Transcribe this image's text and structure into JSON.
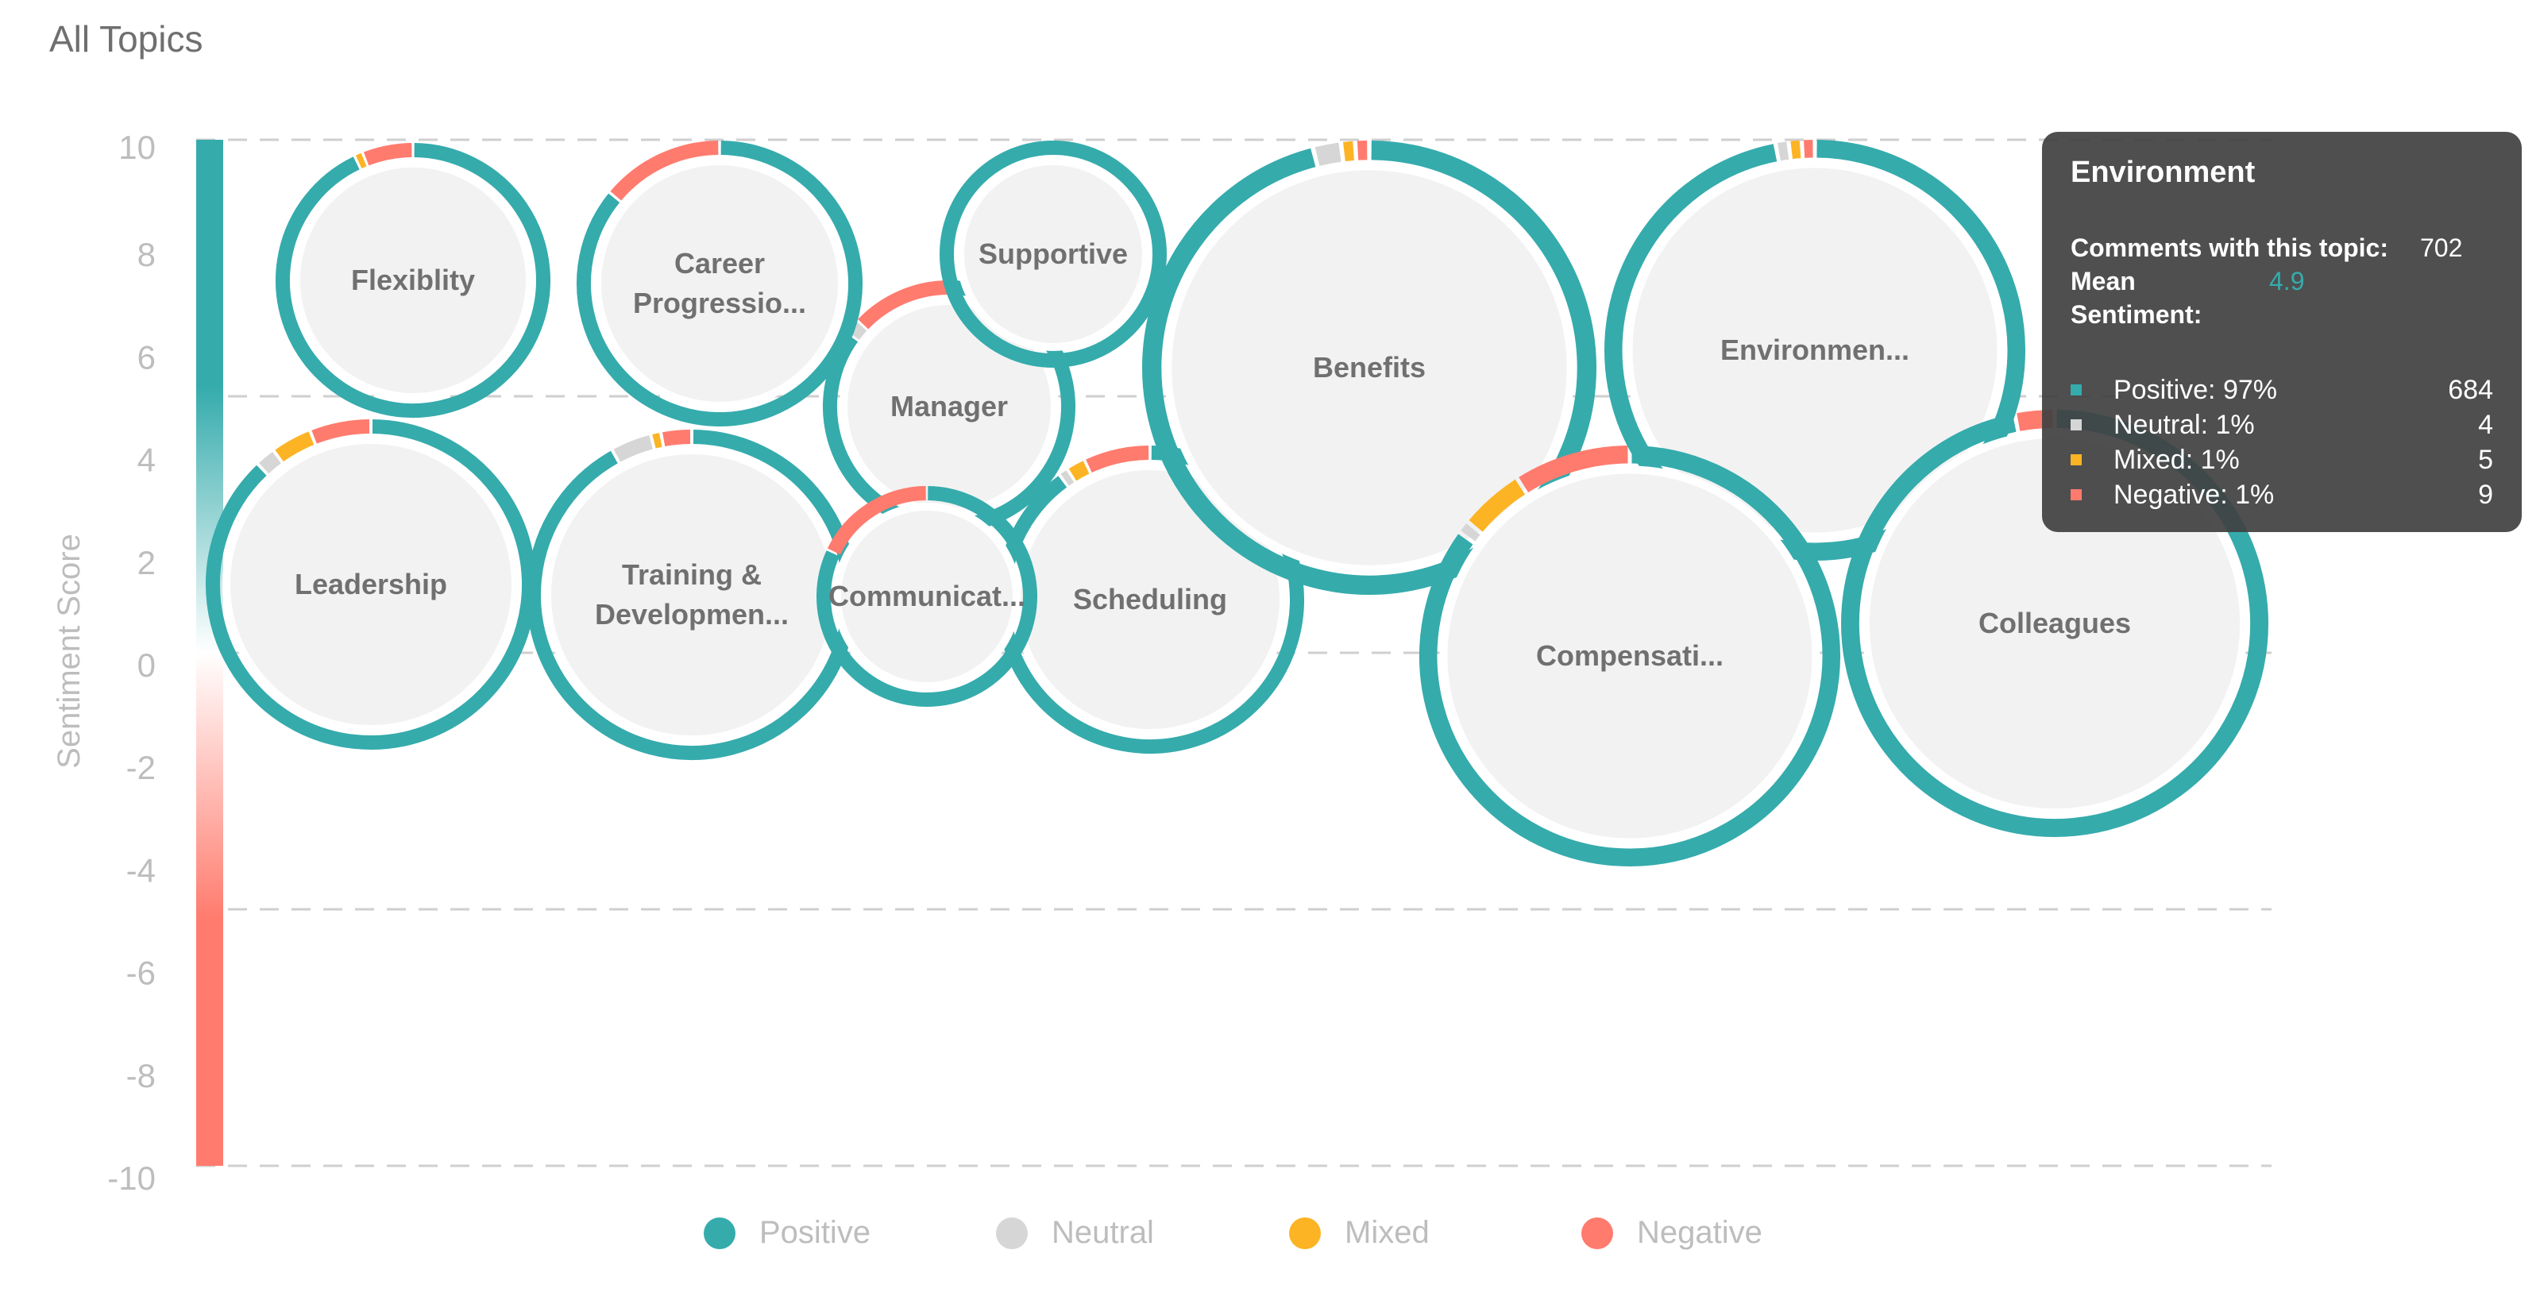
{
  "page": {
    "title": "All Topics"
  },
  "colors": {
    "positive": "#35abac",
    "neutral": "#d6d6d6",
    "mixed": "#fcb424",
    "negative": "#ff7b6e",
    "bubble_fill": "#f2f2f2",
    "label": "#707070",
    "axis_text": "#bdbdbd"
  },
  "chart_data": {
    "type": "bubble",
    "title": "All Topics",
    "ylabel": "Sentiment Score",
    "ylim": [
      -10,
      10
    ],
    "yticks": [
      "10",
      "8",
      "6",
      "4",
      "2",
      "0",
      "-2",
      "-4",
      "-6",
      "-8",
      "-10"
    ],
    "gridlines": [
      10,
      5,
      0,
      -5,
      -10
    ],
    "legend": {
      "placement": "bottom",
      "entries": [
        {
          "key": "positive",
          "label": "Positive"
        },
        {
          "key": "neutral",
          "label": "Neutral"
        },
        {
          "key": "mixed",
          "label": "Mixed"
        },
        {
          "key": "negative",
          "label": "Negative"
        }
      ]
    },
    "bubbles": [
      {
        "label": "Flexiblity",
        "sentiment": 7.2,
        "positive": 0.93,
        "neutral": 0.0,
        "mixed": 0.01,
        "negative": 0.06
      },
      {
        "label": "Career Progressio...",
        "sentiment": 7.1,
        "positive": 0.86,
        "neutral": 0.0,
        "mixed": 0.0,
        "negative": 0.14
      },
      {
        "label": "Supportive",
        "sentiment": 8.3,
        "positive": 1.0,
        "neutral": 0.0,
        "mixed": 0.0,
        "negative": 0.0
      },
      {
        "label": "Manager",
        "sentiment": 5.2,
        "positive": 0.85,
        "neutral": 0.02,
        "mixed": 0.0,
        "negative": 0.13
      },
      {
        "label": "Benefits",
        "sentiment": 5.8,
        "positive": 0.96,
        "neutral": 0.02,
        "mixed": 0.01,
        "negative": 0.01
      },
      {
        "label": "Environmen...",
        "sentiment": 4.9,
        "positive": 0.97,
        "neutral": 0.01,
        "mixed": 0.01,
        "negative": 0.01
      },
      {
        "label": "Leadership",
        "sentiment": 1.5,
        "positive": 0.88,
        "neutral": 0.02,
        "mixed": 0.04,
        "negative": 0.06
      },
      {
        "label": "Training & Developmen...",
        "sentiment": 1.2,
        "positive": 0.92,
        "neutral": 0.04,
        "mixed": 0.01,
        "negative": 0.03
      },
      {
        "label": "Communicat...",
        "sentiment": 1.3,
        "positive": 0.82,
        "neutral": 0.0,
        "mixed": 0.0,
        "negative": 0.18
      },
      {
        "label": "Scheduling",
        "sentiment": 1.3,
        "positive": 0.9,
        "neutral": 0.01,
        "mixed": 0.02,
        "negative": 0.07
      },
      {
        "label": "Compensati...",
        "sentiment": 0.1,
        "positive": 0.85,
        "neutral": 0.01,
        "mixed": 0.05,
        "negative": 0.09
      },
      {
        "label": "Colleagues",
        "sentiment": 0.7,
        "positive": 0.97,
        "neutral": 0.0,
        "mixed": 0.0,
        "negative": 0.03
      }
    ]
  },
  "tooltip": {
    "title": "Environment",
    "comments_label": "Comments with this topic:",
    "comments_value": "702",
    "mean_label": "Mean Sentiment:",
    "mean_value": "4.9",
    "items": [
      {
        "key": "positive",
        "label": "Positive: 97%",
        "count": "684"
      },
      {
        "key": "neutral",
        "label": "Neutral: 1%",
        "count": "4"
      },
      {
        "key": "mixed",
        "label": "Mixed: 1%",
        "count": "5"
      },
      {
        "key": "negative",
        "label": "Negative: 1%",
        "count": "9"
      }
    ]
  }
}
